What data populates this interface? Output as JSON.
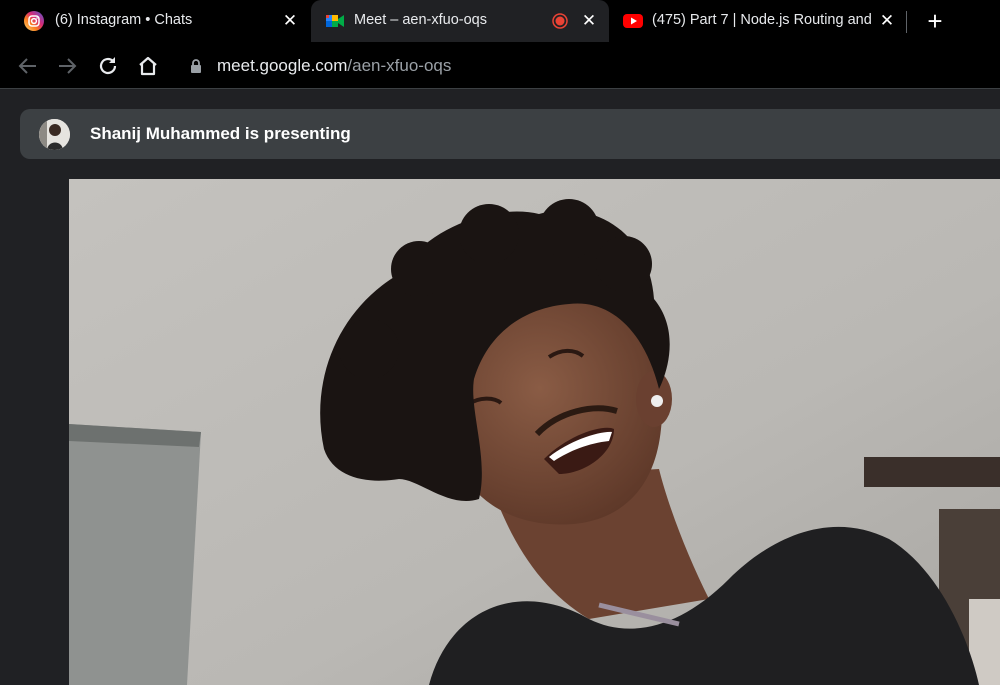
{
  "tabs": [
    {
      "title": "(6) Instagram • Chats",
      "icon": "instagram-icon",
      "active": false
    },
    {
      "title": "Meet – aen-xfuo-oqs",
      "icon": "google-meet-icon",
      "active": true,
      "recording": true
    },
    {
      "title": "(475) Part 7 | Node.js Routing and",
      "icon": "youtube-icon",
      "active": false
    }
  ],
  "toolbar": {
    "url_host": "meet.google.com",
    "url_path": "/aen-xfuo-oqs"
  },
  "meet": {
    "presenting_text": "Shanij Muhammed is presenting"
  },
  "colors": {
    "tabstrip_bg": "#000000",
    "active_tab_bg": "#202124",
    "banner_bg": "#3c4043",
    "recording_dot": "#ea4335",
    "youtube_red": "#ff0000"
  }
}
